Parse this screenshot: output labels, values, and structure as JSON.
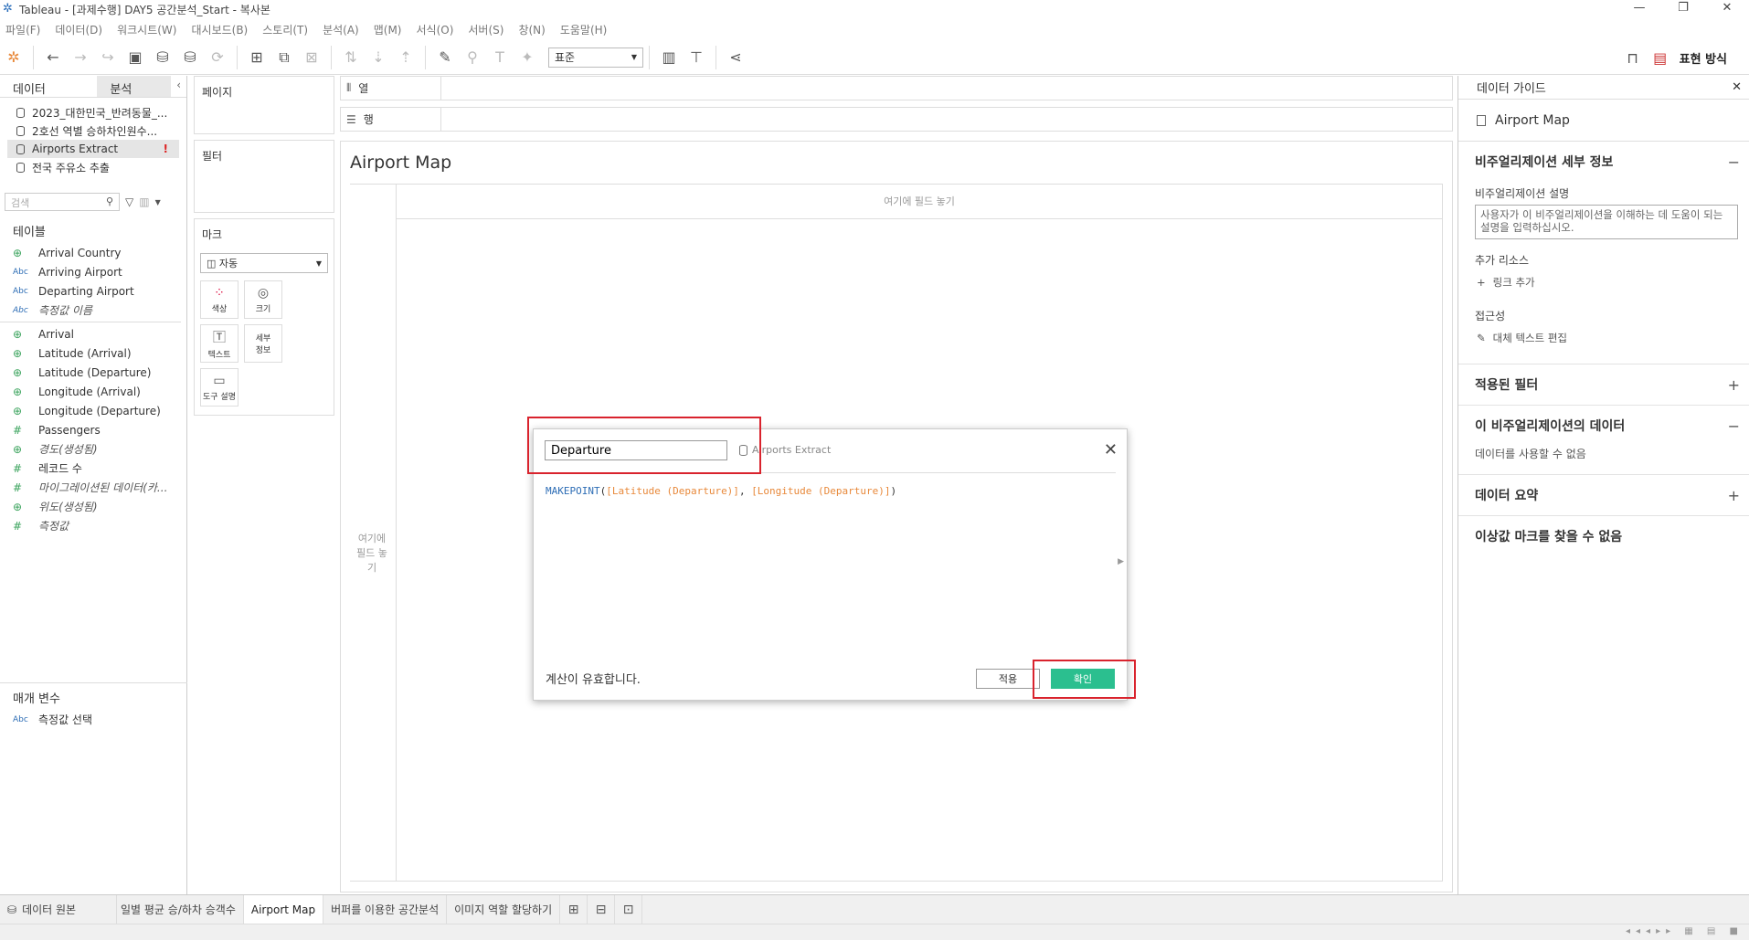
{
  "window": {
    "title": "Tableau - [과제수행] DAY5 공간분석_Start - 복사본"
  },
  "menu": [
    "파일(F)",
    "데이터(D)",
    "워크시트(W)",
    "대시보드(B)",
    "스토리(T)",
    "분석(A)",
    "맵(M)",
    "서식(O)",
    "서버(S)",
    "창(N)",
    "도움말(H)"
  ],
  "toolbar": {
    "view_size": "표준",
    "present_label": "표현 방식"
  },
  "left_panel": {
    "tab_data": "데이터",
    "tab_analysis": "분석",
    "datasources": [
      {
        "name": "2023_대한민국_반려동물_..."
      },
      {
        "name": "2호선 역별 승하차인원수..."
      },
      {
        "name": "Airports Extract",
        "error": "!"
      },
      {
        "name": "전국 주유소 추출"
      }
    ],
    "search_placeholder": "검색",
    "tables_header": "테이블",
    "dimensions": [
      {
        "type": "globe",
        "name": "Arrival Country"
      },
      {
        "type": "Abc",
        "name": "Arriving Airport"
      },
      {
        "type": "Abc",
        "name": "Departing Airport"
      },
      {
        "type": "Abc",
        "name": "측정값 이름",
        "italic": true
      }
    ],
    "measures": [
      {
        "type": "globe",
        "name": "Arrival"
      },
      {
        "type": "globe",
        "name": "Latitude (Arrival)"
      },
      {
        "type": "globe",
        "name": "Latitude (Departure)"
      },
      {
        "type": "globe",
        "name": "Longitude (Arrival)"
      },
      {
        "type": "globe",
        "name": "Longitude (Departure)"
      },
      {
        "type": "#",
        "name": "Passengers"
      },
      {
        "type": "globe",
        "name": "경도(생성됨)",
        "italic": true
      },
      {
        "type": "#",
        "name": "레코드 수"
      },
      {
        "type": "#",
        "name": "마이그레이션된 데이터(카...",
        "italic": true
      },
      {
        "type": "globe",
        "name": "위도(생성됨)",
        "italic": true
      },
      {
        "type": "#",
        "name": "측정값",
        "italic": true
      }
    ],
    "params_header": "매개 변수",
    "params": [
      {
        "type": "Abc",
        "name": "측정값 선택"
      }
    ]
  },
  "shelves": {
    "pages": "페이지",
    "filters": "필터",
    "marks": "마크",
    "mark_type": "자동",
    "mark_buttons": [
      "색상",
      "크기",
      "텍스트",
      "세부 정보",
      "도구 설명"
    ],
    "columns": "열",
    "rows": "행"
  },
  "canvas": {
    "title": "Airport Map",
    "drop_top": "여기에 필드 놓기",
    "drop_left": "여기에 필드 놓기"
  },
  "calc_dialog": {
    "name": "Departure",
    "source": "Airports Extract",
    "formula_fn": "MAKEPOINT",
    "formula_arg1": "[Latitude (Departure)]",
    "formula_arg2": "[Longitude (Departure)]",
    "status": "계산이 유효합니다.",
    "apply": "적용",
    "ok": "확인",
    "ok_color": "#2bbf8f"
  },
  "right_panel": {
    "title": "데이터 가이드",
    "sheet": "Airport Map",
    "viz_details": "비주얼리제이션 세부 정보",
    "desc_label": "비주얼리제이션 설명",
    "desc_placeholder": "사용자가 이 비주얼리제이션을 이해하는 데 도움이 되는 설명을 입력하십시오.",
    "resources_label": "추가 리소스",
    "add_link": "링크 추가",
    "access_label": "접근성",
    "alt_text": "대체 텍스트 편집",
    "applied_filters": "적용된 필터",
    "viz_data": "이 비주얼리제이션의 데이터",
    "data_unavailable": "데이터를 사용할 수 없음",
    "data_summary": "데이터 요약",
    "outliers": "이상값 마크를 찾을 수 없음"
  },
  "sheet_tabs": [
    "데이터 원본",
    "일별 평균 승/하차 승객수",
    "Airport Map",
    "버퍼를 이용한 공간분석",
    "이미지 역할 할당하기"
  ],
  "active_tab": "Airport Map"
}
